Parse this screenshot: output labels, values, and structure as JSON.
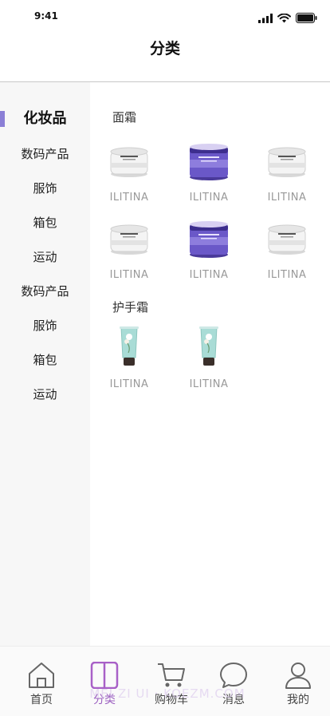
{
  "status_bar": {
    "time": "9:41"
  },
  "nav": {
    "title": "分类"
  },
  "sidebar": {
    "items": [
      {
        "label": "化妆品"
      },
      {
        "label": "数码产品"
      },
      {
        "label": "服饰"
      },
      {
        "label": "箱包"
      },
      {
        "label": "运动"
      },
      {
        "label": "数码产品"
      },
      {
        "label": "服饰"
      },
      {
        "label": "箱包"
      },
      {
        "label": "运动"
      }
    ]
  },
  "sections": [
    {
      "title": "面霜",
      "products": [
        {
          "name": "ILITINA",
          "icon": "white-cream-jar-icon"
        },
        {
          "name": "ILITINA",
          "icon": "purple-cream-jar-icon"
        },
        {
          "name": "ILITINA",
          "icon": "white-cream-jar-icon"
        },
        {
          "name": "ILITINA",
          "icon": "white-cream-jar-icon"
        },
        {
          "name": "ILITINA",
          "icon": "purple-cream-jar-icon"
        },
        {
          "name": "ILITINA",
          "icon": "white-cream-jar-icon"
        }
      ]
    },
    {
      "title": "护手霜",
      "products": [
        {
          "name": "ILITINA",
          "icon": "hand-cream-tube-icon"
        },
        {
          "name": "ILITINA",
          "icon": "hand-cream-tube-icon"
        }
      ]
    }
  ],
  "tabbar": {
    "tabs": [
      {
        "label": "首页",
        "icon": "home-icon"
      },
      {
        "label": "分类",
        "icon": "category-icon"
      },
      {
        "label": "购物车",
        "icon": "cart-icon"
      },
      {
        "label": "消息",
        "icon": "message-icon"
      },
      {
        "label": "我的",
        "icon": "profile-icon"
      }
    ]
  },
  "watermark": "MEI ZI UI  ·  KOEZM.COM",
  "colors": {
    "accent": "#8b7fd6",
    "active_tab": "#9b5fc0",
    "sidebar_bg": "#f7f7f7",
    "product_name": "#999999"
  }
}
